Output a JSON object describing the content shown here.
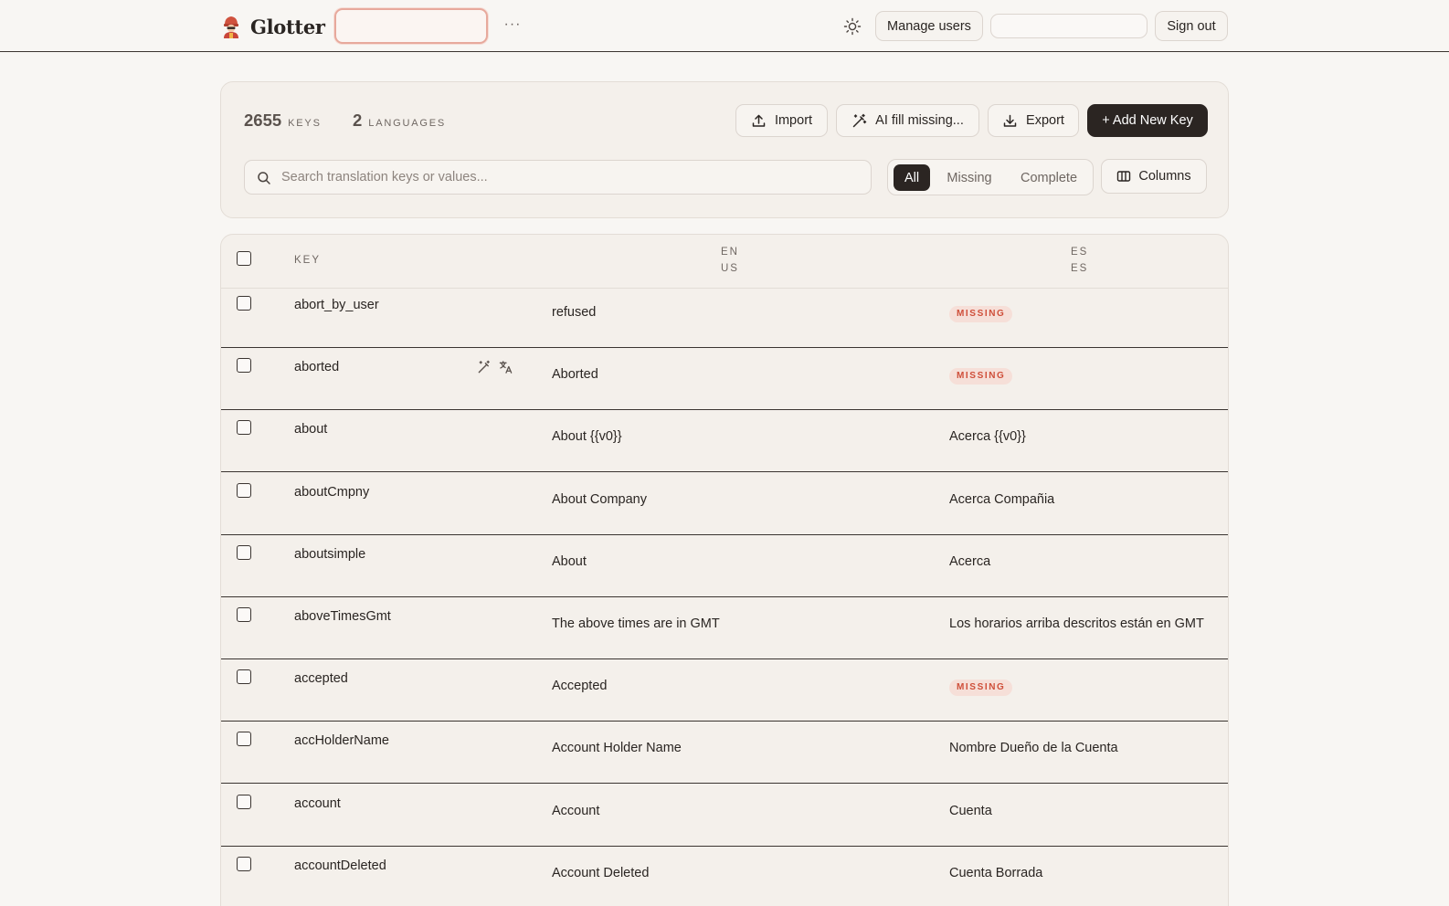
{
  "header": {
    "brand_name": "Glotter",
    "project_select_value": "",
    "more_label": "···",
    "manage_users_label": "Manage users",
    "user_value": "",
    "sign_out_label": "Sign out"
  },
  "summary": {
    "keys_count": "2655",
    "keys_label": "KEYS",
    "languages_count": "2",
    "languages_label": "LANGUAGES",
    "import_label": "Import",
    "ai_fill_label": "AI fill missing...",
    "export_label": "Export",
    "add_key_label": "+ Add New Key",
    "search_placeholder": "Search translation keys or values...",
    "filters": {
      "all": "All",
      "missing": "Missing",
      "complete": "Complete",
      "selected": "All"
    },
    "columns_label": "Columns"
  },
  "table": {
    "columns": {
      "key": "KEY",
      "en_line1": "EN",
      "en_line2": "US",
      "es_line1": "ES",
      "es_line2": "ES"
    },
    "missing_label": "MISSING",
    "rows": [
      {
        "key": "abort_by_user",
        "en": "refused",
        "es": "",
        "es_missing": true
      },
      {
        "key": "aborted",
        "en": "Aborted",
        "es": "",
        "es_missing": true,
        "hovered": true
      },
      {
        "key": "about",
        "en": "About {{v0}}",
        "es": "Acerca {{v0}}",
        "es_missing": false
      },
      {
        "key": "aboutCmpny",
        "en": "About Company",
        "es": "Acerca Compañia",
        "es_missing": false
      },
      {
        "key": "aboutsimple",
        "en": "About",
        "es": "Acerca",
        "es_missing": false
      },
      {
        "key": "aboveTimesGmt",
        "en": "The above times are in GMT",
        "es": "Los horarios arriba descritos están en GMT",
        "es_missing": false
      },
      {
        "key": "accepted",
        "en": "Accepted",
        "es": "",
        "es_missing": true
      },
      {
        "key": "accHolderName",
        "en": "Account Holder Name",
        "es": "Nombre Dueño de la Cuenta",
        "es_missing": false
      },
      {
        "key": "account",
        "en": "Account",
        "es": "Cuenta",
        "es_missing": false
      },
      {
        "key": "accountDeleted",
        "en": "Account Deleted",
        "es": "Cuenta Borrada",
        "es_missing": false
      }
    ]
  },
  "colors": {
    "accent_dark": "#2b2522",
    "missing_badge_bg": "#f6dfd8",
    "missing_badge_text": "#cf4f3a",
    "project_select_border": "#e7a99c"
  },
  "icons": [
    "logo-icon",
    "more-icon",
    "sun-icon",
    "upload-icon",
    "magic-wand-icon",
    "download-icon",
    "search-icon",
    "columns-icon",
    "translate-icon"
  ]
}
